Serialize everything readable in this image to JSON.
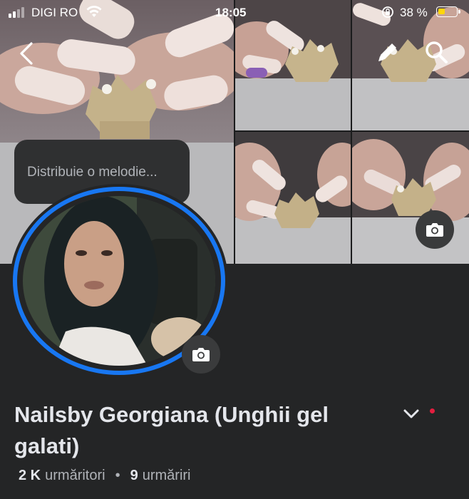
{
  "status_bar": {
    "carrier": "DIGI RO",
    "time": "18:05",
    "battery_percent": "38 %",
    "battery_level": 0.38,
    "battery_color": "#ffd60a"
  },
  "header": {
    "back_icon": "chevron-left-icon",
    "edit_icon": "pencil-icon",
    "search_icon": "search-icon"
  },
  "music_bubble": {
    "text": "Distribuie o melodie..."
  },
  "profile": {
    "name": "Nailsby Georgiana (Unghii gel galati)",
    "followers_count": "2 K",
    "followers_label": "urmăritori",
    "separator": "•",
    "following_count": "9",
    "following_label": "urmăriri"
  },
  "colors": {
    "background": "#242526",
    "accent_ring": "#1877f2",
    "notification_dot": "#e41e3f"
  }
}
